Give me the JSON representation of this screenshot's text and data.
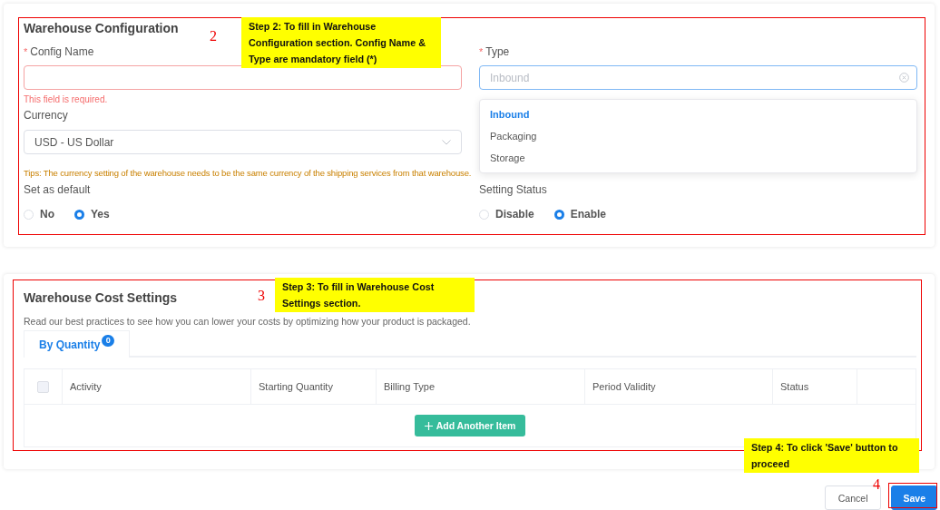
{
  "warehouse_configuration": {
    "title": "Warehouse Configuration",
    "config_name": {
      "required_mark": "*",
      "label": "Config Name",
      "error": "This field is required."
    },
    "type": {
      "required_mark": "*",
      "label": "Type",
      "placeholder": "Inbound",
      "focused": true,
      "expanded": true,
      "options": [
        {
          "label": "Inbound",
          "selected": true
        },
        {
          "label": "Packaging",
          "selected": false
        },
        {
          "label": "Storage",
          "selected": false
        }
      ]
    },
    "currency": {
      "label": "Currency",
      "value": "USD - US Dollar"
    },
    "tips": "Tips: The currency setting of the warehouse needs to be the same currency of the shipping services from that warehouse.",
    "set_as_default": {
      "label": "Set as default",
      "options": [
        {
          "label": "No",
          "selected": false
        },
        {
          "label": "Yes",
          "selected": true
        }
      ]
    },
    "setting_status": {
      "label": "Setting Status",
      "options": [
        {
          "label": "Disable",
          "selected": false
        },
        {
          "label": "Enable",
          "selected": true
        }
      ]
    }
  },
  "warehouse_cost_settings": {
    "title": "Warehouse Cost Settings",
    "description": "Read our best practices to see how you can lower your costs by optimizing how your product is packaged.",
    "tabs": [
      {
        "label": "By Quantity",
        "badge": "0",
        "selected": true
      }
    ],
    "table": {
      "select_all_checked": false,
      "columns": [
        "Activity",
        "Starting Quantity",
        "Billing Type",
        "Period Validity",
        "Status"
      ]
    },
    "add_button": "Add Another Item"
  },
  "actions": [
    {
      "label": "Cancel",
      "kind": "secondary"
    },
    {
      "label": "Save",
      "kind": "primary"
    }
  ],
  "annotations": [
    {
      "number": "2",
      "text": "Step 2: To fill in Warehouse Configuration section. Config Name & Type are mandatory field (*)"
    },
    {
      "number": "3",
      "text": "Step 3: To fill in Warehouse Cost Settings section."
    },
    {
      "number": "4",
      "text": "Step 4: To click 'Save' button to proceed"
    }
  ]
}
